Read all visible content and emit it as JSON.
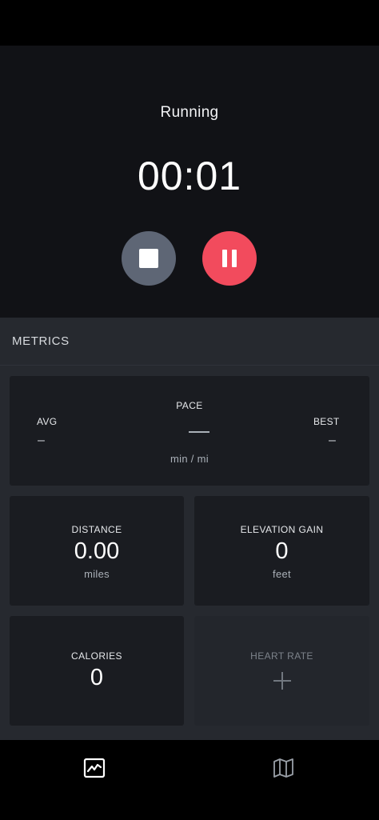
{
  "header": {
    "activity": "Running",
    "timer": "00:01",
    "stop_icon": "stop-icon",
    "pause_icon": "pause-icon"
  },
  "metrics": {
    "section_title": "METRICS",
    "pace": {
      "label": "PACE",
      "value": "—",
      "unit": "min / mi",
      "avg_label": "AVG",
      "avg_value": "–",
      "best_label": "BEST",
      "best_value": "–"
    },
    "distance": {
      "label": "DISTANCE",
      "value": "0.00",
      "unit": "miles"
    },
    "elevation": {
      "label": "ELEVATION GAIN",
      "value": "0",
      "unit": "feet"
    },
    "calories": {
      "label": "CALORIES",
      "value": "0"
    },
    "heart_rate": {
      "label": "HEART RATE",
      "icon": "plus-icon"
    }
  },
  "tab_bar": {
    "tabs": [
      {
        "name": "metrics",
        "icon": "chart-icon",
        "active": true
      },
      {
        "name": "map",
        "icon": "map-icon",
        "active": false
      }
    ]
  },
  "colors": {
    "stop_button": "#5e6675",
    "pause_button": "#f24b5d",
    "background": "#111216",
    "card": "#1a1c21"
  }
}
